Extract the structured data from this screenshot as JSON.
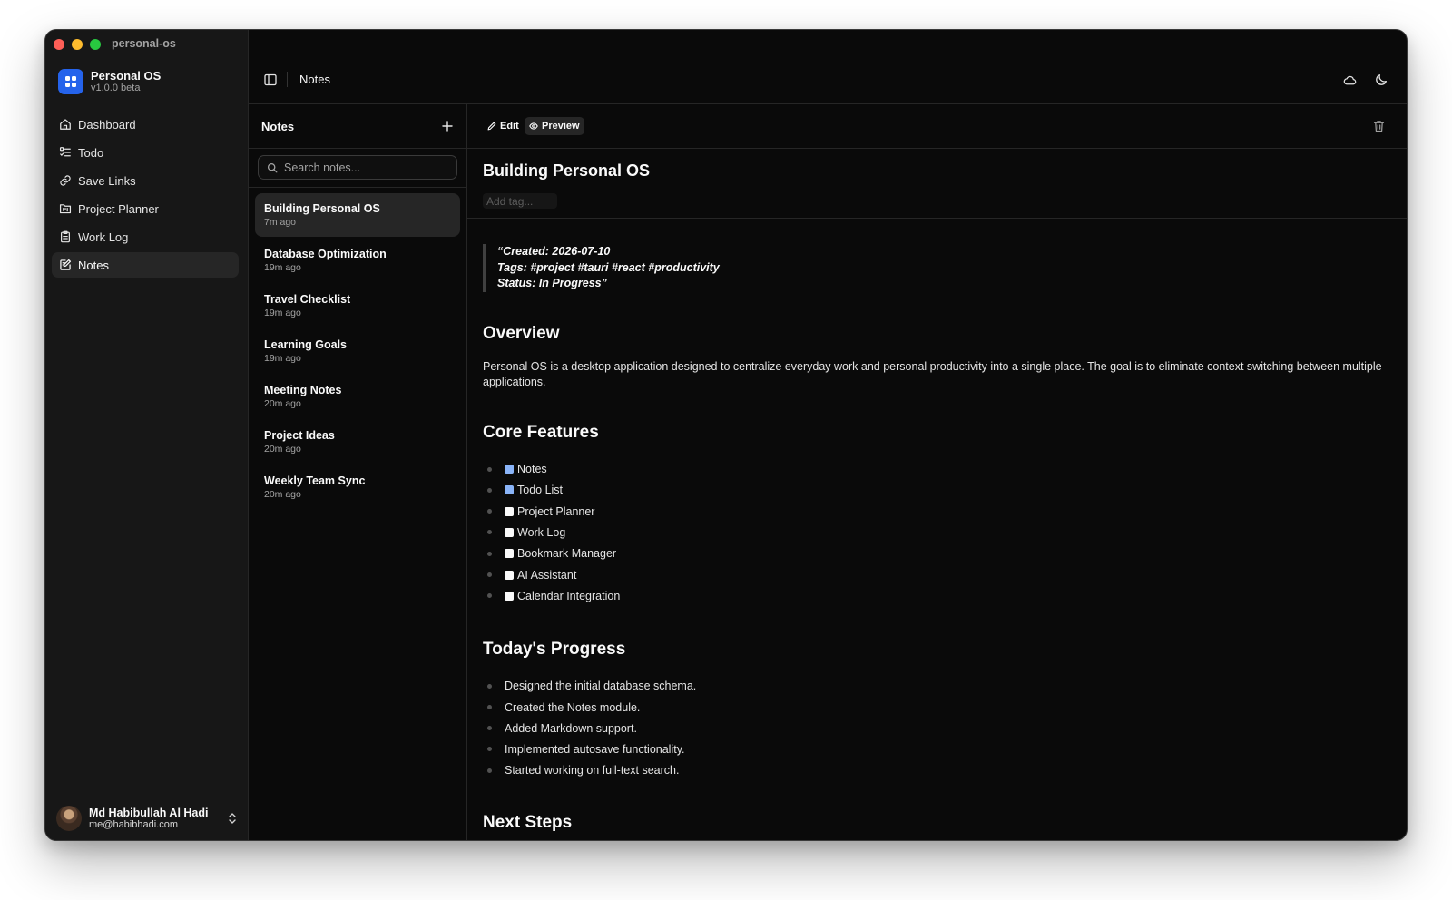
{
  "window": {
    "title": "personal-os"
  },
  "brand": {
    "name": "Personal OS",
    "version": "v1.0.0 beta"
  },
  "nav": {
    "items": [
      {
        "label": "Dashboard",
        "icon": "home-icon",
        "active": false
      },
      {
        "label": "Todo",
        "icon": "list-todo-icon",
        "active": false
      },
      {
        "label": "Save Links",
        "icon": "link-icon",
        "active": false
      },
      {
        "label": "Project Planner",
        "icon": "folder-kanban-icon",
        "active": false
      },
      {
        "label": "Work Log",
        "icon": "clipboard-icon",
        "active": false
      },
      {
        "label": "Notes",
        "icon": "edit-note-icon",
        "active": true
      }
    ]
  },
  "user": {
    "name": "Md Habibullah Al Hadi",
    "email": "me@habibhadi.com"
  },
  "topbar": {
    "breadcrumb": "Notes"
  },
  "notes_panel": {
    "title": "Notes",
    "search_placeholder": "Search notes...",
    "items": [
      {
        "title": "Building Personal OS",
        "time": "7m ago",
        "active": true
      },
      {
        "title": "Database Optimization",
        "time": "19m ago",
        "active": false
      },
      {
        "title": "Travel Checklist",
        "time": "19m ago",
        "active": false
      },
      {
        "title": "Learning Goals",
        "time": "19m ago",
        "active": false
      },
      {
        "title": "Meeting Notes",
        "time": "20m ago",
        "active": false
      },
      {
        "title": "Project Ideas",
        "time": "20m ago",
        "active": false
      },
      {
        "title": "Weekly Team Sync",
        "time": "20m ago",
        "active": false
      }
    ]
  },
  "editor": {
    "mode_edit": "Edit",
    "mode_preview": "Preview",
    "title": "Building Personal OS",
    "tag_placeholder": "Add tag...",
    "quote_lines": [
      "“Created: 2026-07-10",
      "Tags: #project #tauri #react #productivity",
      "Status: In Progress”"
    ],
    "overview_heading": "Overview",
    "overview_text": "Personal OS is a desktop application designed to centralize everyday work and personal productivity into a single place. The goal is to eliminate context switching between multiple applications.",
    "features_heading": "Core Features",
    "features": [
      {
        "label": "Notes",
        "checked": true
      },
      {
        "label": "Todo List",
        "checked": true
      },
      {
        "label": "Project Planner",
        "checked": false
      },
      {
        "label": "Work Log",
        "checked": false
      },
      {
        "label": "Bookmark Manager",
        "checked": false
      },
      {
        "label": "AI Assistant",
        "checked": false
      },
      {
        "label": "Calendar Integration",
        "checked": false
      }
    ],
    "progress_heading": "Today's Progress",
    "progress": [
      "Designed the initial database schema.",
      "Created the Notes module.",
      "Added Markdown support.",
      "Implemented autosave functionality.",
      "Started working on full-text search."
    ],
    "next_heading": "Next Steps"
  },
  "colors": {
    "accent": "#2563eb",
    "checked": "#8ab4f8",
    "background": "#0a0a0a",
    "sidebar": "#171717"
  }
}
